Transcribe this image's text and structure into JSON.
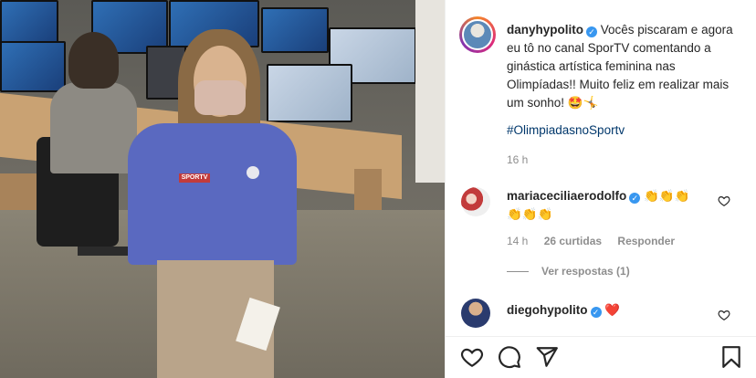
{
  "post": {
    "author": "danyhypolito",
    "caption": "Vocês piscaram e agora eu tô no canal SporTV comentando a ginástica artística feminina nas Olimpíadas!! Muito feliz em realizar mais um sonho! 🤩🤸",
    "hashtag": "#OlimpiadasnoSportv",
    "time": "16 h"
  },
  "comments": [
    {
      "user": "mariaceciliaerodolfo",
      "text_line1": "👏👏👏",
      "text_line2": "👏👏👏",
      "time": "14 h",
      "likes": "26 curtidas",
      "reply": "Responder",
      "view_replies": "Ver respostas (1)"
    },
    {
      "user": "diegohypolito",
      "text": "❤️"
    }
  ],
  "photo": {
    "logo_text": "SPORTV"
  },
  "icons": {
    "verified": "✓",
    "like": "heart-icon",
    "comment": "comment-icon",
    "share": "share-icon",
    "save": "bookmark-icon"
  },
  "colors": {
    "verified": "#3897f0",
    "heart_red": "#ed4956",
    "hashtag": "#00376b",
    "meta": "#8e8e8e"
  }
}
